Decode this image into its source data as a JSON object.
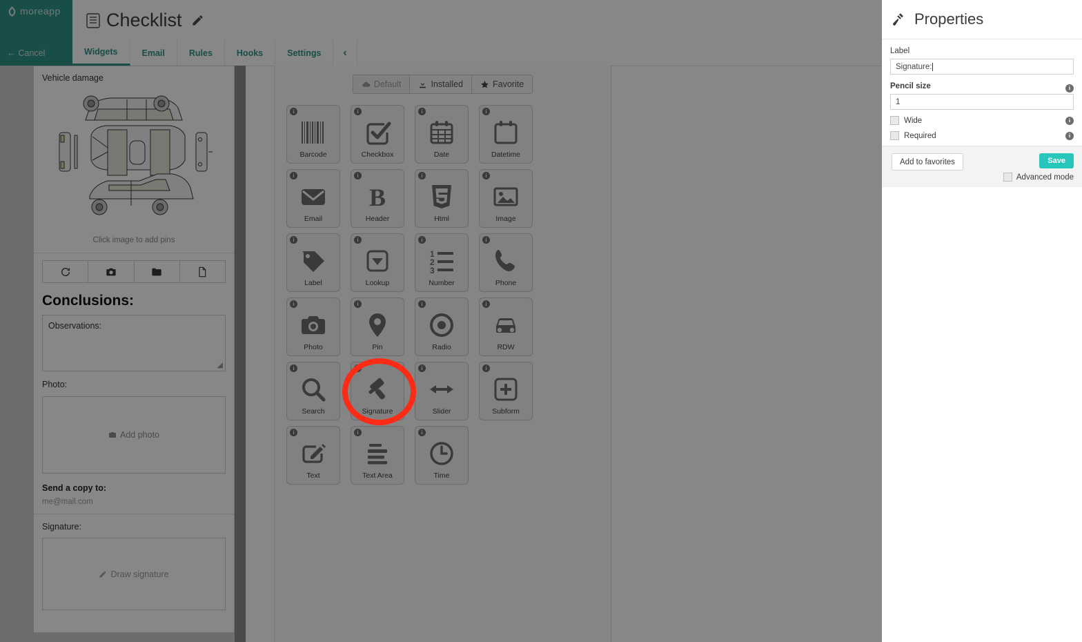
{
  "brand": {
    "name": "moreapp",
    "logo_icon": "leaf-logo-icon",
    "cancel_label": "Cancel",
    "back_arrow_icon": "arrow-left-icon"
  },
  "header": {
    "title": "Checklist",
    "doc_icon": "document-icon",
    "edit_icon": "pencil-icon"
  },
  "tabs": [
    {
      "label": "Widgets",
      "active": true
    },
    {
      "label": "Email",
      "active": false
    },
    {
      "label": "Rules",
      "active": false
    },
    {
      "label": "Hooks",
      "active": false
    },
    {
      "label": "Settings",
      "active": false
    },
    {
      "label": "‹",
      "active": false,
      "icon": "chevron-left-icon"
    }
  ],
  "preview": {
    "vehicle_damage_label": "Vehicle damage",
    "image_hint": "Click image to add pins",
    "image_actions": [
      {
        "name": "rotate-icon"
      },
      {
        "name": "camera-icon"
      },
      {
        "name": "folder-icon"
      },
      {
        "name": "file-icon"
      }
    ],
    "conclusions_heading": "Conclusions:",
    "observations_label": "Observations:",
    "photo_label": "Photo:",
    "add_photo_label": "Add photo",
    "send_copy_label": "Send a copy to:",
    "send_copy_value": "me@mail.com",
    "signature_label": "Signature:",
    "draw_signature_label": "Draw signature"
  },
  "catalog": {
    "filters": [
      {
        "label": "Default",
        "icon": "cloud-icon",
        "state": "muted"
      },
      {
        "label": "Installed",
        "icon": "download-icon",
        "state": "normal"
      },
      {
        "label": "Favorite",
        "icon": "star-icon",
        "state": "normal"
      }
    ],
    "widgets": [
      {
        "label": "Barcode",
        "icon": "barcode-icon"
      },
      {
        "label": "Checkbox",
        "icon": "checkbox-icon"
      },
      {
        "label": "Date",
        "icon": "calendar-icon"
      },
      {
        "label": "Datetime",
        "icon": "calendar-blank-icon"
      },
      {
        "label": "Email",
        "icon": "envelope-icon"
      },
      {
        "label": "Header",
        "icon": "bold-b-icon"
      },
      {
        "label": "Html",
        "icon": "html5-icon"
      },
      {
        "label": "Image",
        "icon": "image-icon"
      },
      {
        "label": "Label",
        "icon": "tag-icon"
      },
      {
        "label": "Lookup",
        "icon": "dropdown-icon"
      },
      {
        "label": "Number",
        "icon": "numbered-list-icon"
      },
      {
        "label": "Phone",
        "icon": "phone-icon"
      },
      {
        "label": "Photo",
        "icon": "camera-icon"
      },
      {
        "label": "Pin",
        "icon": "map-pin-icon"
      },
      {
        "label": "Radio",
        "icon": "radio-button-icon"
      },
      {
        "label": "RDW",
        "icon": "car-icon"
      },
      {
        "label": "Search",
        "icon": "magnifier-icon"
      },
      {
        "label": "Signature",
        "icon": "gavel-icon",
        "highlighted": true
      },
      {
        "label": "Slider",
        "icon": "arrows-horizontal-icon"
      },
      {
        "label": "Subform",
        "icon": "plus-square-icon"
      },
      {
        "label": "Text",
        "icon": "text-pencil-icon"
      },
      {
        "label": "Text Area",
        "icon": "text-lines-icon"
      },
      {
        "label": "Time",
        "icon": "clock-icon"
      }
    ],
    "info_badge": "i"
  },
  "properties": {
    "title": "Properties",
    "icon": "gavel-icon",
    "label_field": {
      "label": "Label",
      "value": "Signature:"
    },
    "pencil_field": {
      "label": "Pencil size",
      "value": "1",
      "info": "i"
    },
    "checkboxes": [
      {
        "label": "Wide",
        "checked": false,
        "info": "i"
      },
      {
        "label": "Required",
        "checked": false,
        "info": "i"
      }
    ],
    "favorites_button": "Add to favorites",
    "save_button": "Save",
    "advanced_mode": {
      "label": "Advanced mode",
      "checked": false
    }
  },
  "colors": {
    "brand_teal": "#2e9189",
    "save_teal": "#26c6bb",
    "annotation_red": "#fb2b16"
  }
}
